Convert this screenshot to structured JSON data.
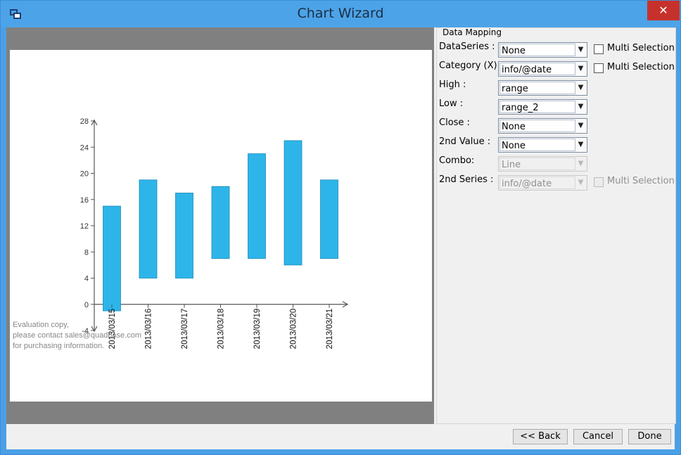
{
  "window": {
    "title": "Chart Wizard",
    "close_symbol": "✕",
    "app_icon": "chart-wizard-icon"
  },
  "watermark": {
    "line1": "Evaluation copy,",
    "line2": "please contact sales@quadbase.com",
    "line3": "for purchasing information."
  },
  "data_mapping": {
    "legend": "Data Mapping",
    "rows": [
      {
        "label": "DataSeries :",
        "value": "None",
        "enabled": true,
        "multi_selection": "Multi Selection",
        "multi_enabled": true
      },
      {
        "label": "Category (X) :",
        "value": "info/@date",
        "enabled": true,
        "multi_selection": "Multi Selection",
        "multi_enabled": true
      },
      {
        "label": "High   :",
        "value": "range",
        "enabled": true
      },
      {
        "label": "Low    :",
        "value": "range_2",
        "enabled": true
      },
      {
        "label": "Close :",
        "value": "None",
        "enabled": true
      },
      {
        "label": "2nd Value :",
        "value": "None",
        "enabled": true
      },
      {
        "label": "Combo:",
        "value": "Line",
        "enabled": false
      },
      {
        "label": "2nd Series :",
        "value": "info/@date",
        "enabled": false,
        "multi_selection": "Multi Selection",
        "multi_enabled": false
      }
    ]
  },
  "buttons": {
    "back": "<< Back",
    "cancel": "Cancel",
    "done": "Done"
  },
  "chart_data": {
    "type": "bar",
    "subtype": "floating-range",
    "categories": [
      "2013/03/15",
      "2013/03/16",
      "2013/03/17",
      "2013/03/18",
      "2013/03/19",
      "2013/03/20",
      "2013/03/21"
    ],
    "series": [
      {
        "name": "",
        "high": [
          15,
          19,
          17,
          18,
          23,
          25,
          19
        ],
        "low": [
          -1,
          4,
          4,
          7,
          7,
          6,
          7
        ]
      }
    ],
    "y_ticks": [
      -4,
      0,
      4,
      8,
      12,
      16,
      20,
      24,
      28
    ],
    "ylim": [
      -4,
      28
    ],
    "title": "",
    "xlabel": "",
    "ylabel": "",
    "grid": false,
    "bar_color": "#2db5ea",
    "bar_edge_color": "#1d8cb8"
  }
}
